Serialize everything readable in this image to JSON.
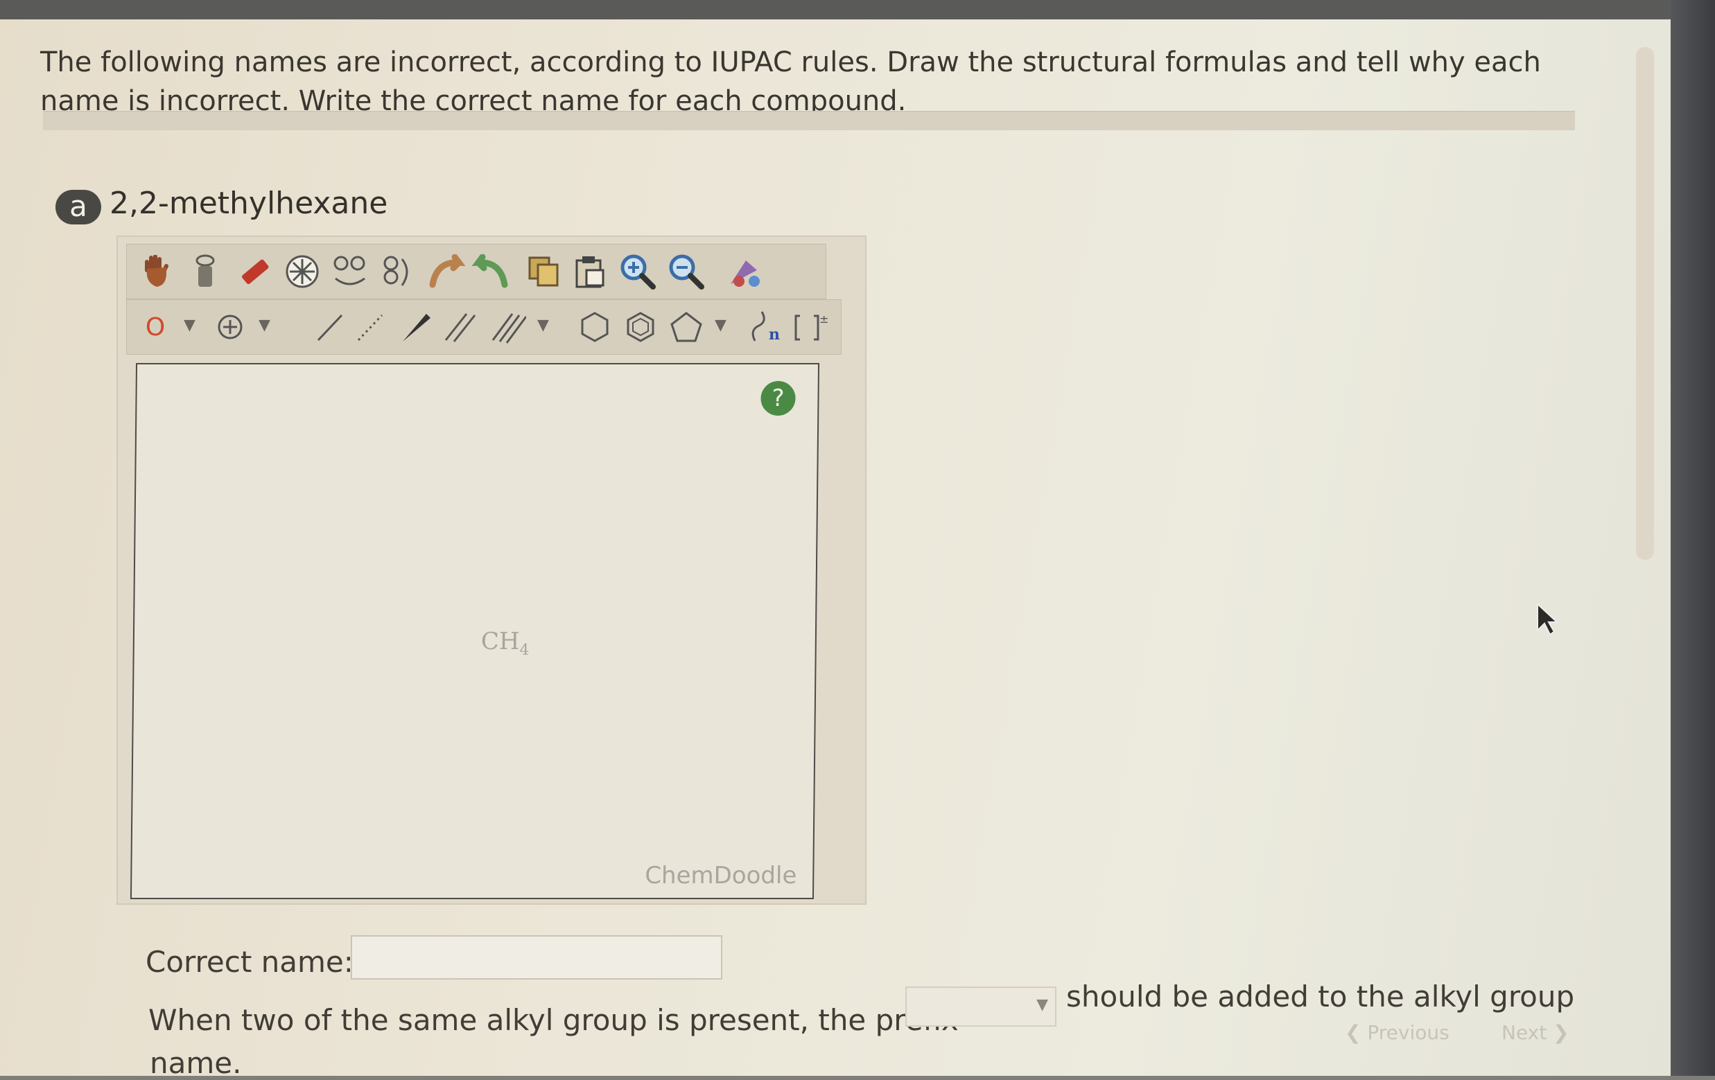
{
  "question": {
    "instructions": "The following names are incorrect, according to IUPAC rules. Draw the structural formulas and tell why each name is incorrect. Write the correct name for each compound.",
    "part_badge": "a",
    "part_label": "2,2-methylhexane"
  },
  "editor": {
    "canvas_placeholder": "CH4",
    "watermark": "ChemDoodle",
    "help_symbol": "?",
    "atom_selector": "O",
    "toolbar_row1_icons": [
      "hand-icon",
      "lasso-icon",
      "eraser-icon",
      "center-icon",
      "flip-icon",
      "rotate-icon",
      "undo-icon",
      "redo-icon",
      "copy-icon",
      "paste-icon",
      "zoom-in-icon",
      "zoom-out-icon",
      "clean-icon"
    ],
    "toolbar_row2_icons": [
      "atom-selector",
      "charge-icon",
      "single-bond-icon",
      "dashed-bond-icon",
      "wedge-bond-icon",
      "double-bond-icon",
      "triple-bond-icon",
      "hexagon-icon",
      "benzene-icon",
      "pentagon-icon",
      "repeat-unit-icon",
      "bracket-charge-icon"
    ]
  },
  "answer": {
    "correct_name_label": "Correct name:",
    "correct_name_value": "",
    "sentence_part1": "When two of the same alkyl group is present, the prefix",
    "prefix_selected": "",
    "sentence_part2": "should be added to the alkyl group",
    "sentence_part3": "name."
  },
  "navigation": {
    "previous_label": "Previous",
    "next_label": "Next"
  }
}
